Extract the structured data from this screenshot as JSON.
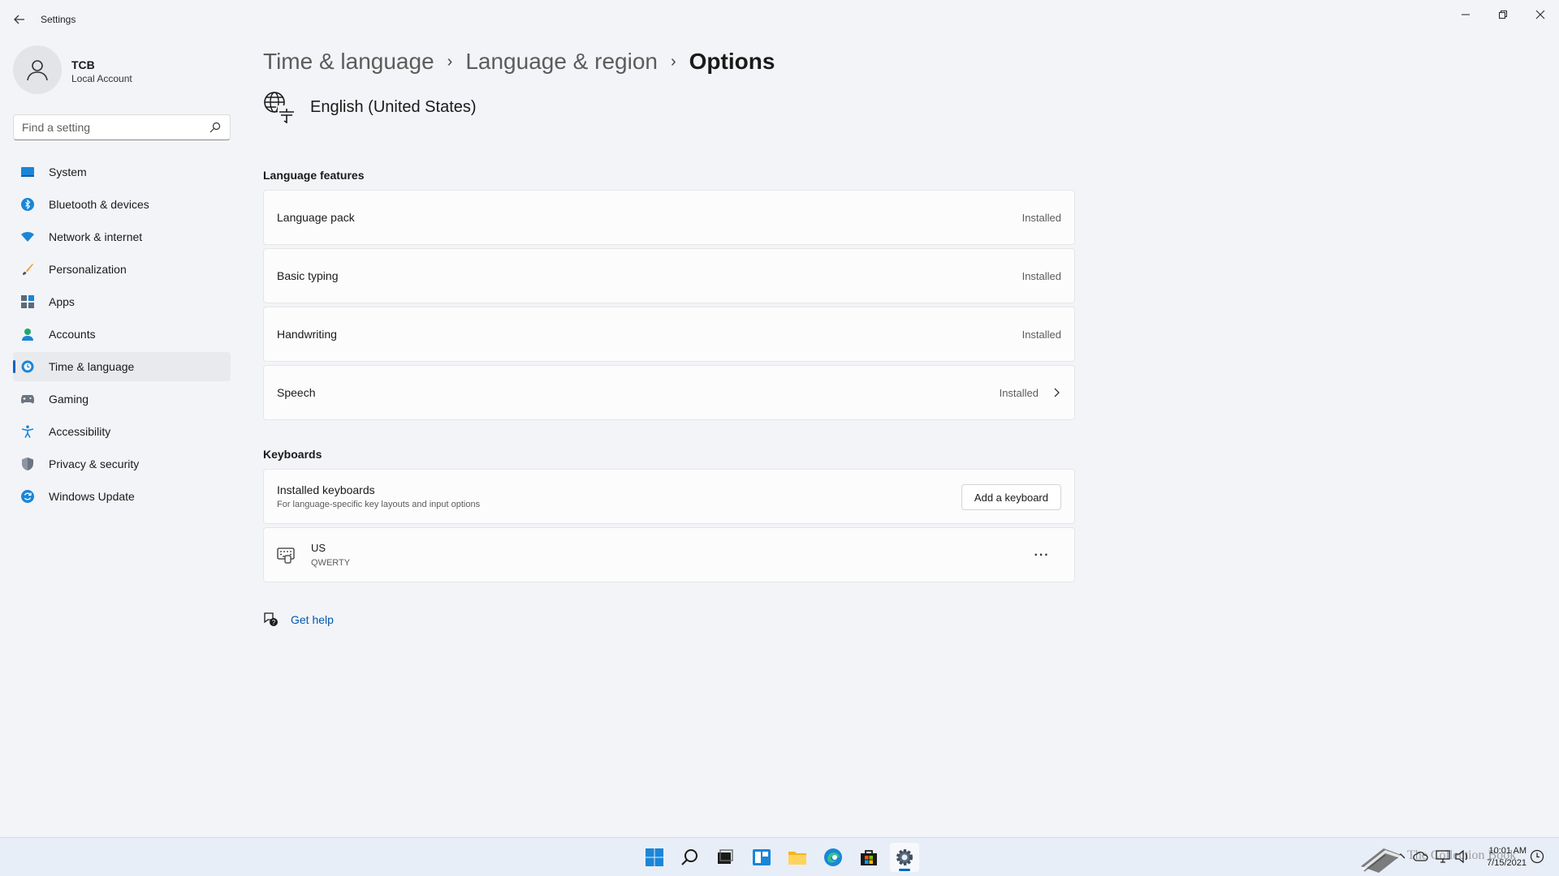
{
  "window": {
    "title": "Settings"
  },
  "profile": {
    "name": "TCB",
    "account_type": "Local Account"
  },
  "search": {
    "placeholder": "Find a setting"
  },
  "sidebar": {
    "items": [
      {
        "label": "System",
        "icon": "monitor-icon",
        "active": false
      },
      {
        "label": "Bluetooth & devices",
        "icon": "bluetooth-icon",
        "active": false
      },
      {
        "label": "Network & internet",
        "icon": "wifi-icon",
        "active": false
      },
      {
        "label": "Personalization",
        "icon": "brush-icon",
        "active": false
      },
      {
        "label": "Apps",
        "icon": "apps-icon",
        "active": false
      },
      {
        "label": "Accounts",
        "icon": "person-icon",
        "active": false
      },
      {
        "label": "Time & language",
        "icon": "globe-clock-icon",
        "active": true
      },
      {
        "label": "Gaming",
        "icon": "gamepad-icon",
        "active": false
      },
      {
        "label": "Accessibility",
        "icon": "accessibility-icon",
        "active": false
      },
      {
        "label": "Privacy & security",
        "icon": "shield-icon",
        "active": false
      },
      {
        "label": "Windows Update",
        "icon": "update-icon",
        "active": false
      }
    ]
  },
  "breadcrumb": {
    "items": [
      "Time & language",
      "Language & region",
      "Options"
    ]
  },
  "language": {
    "name": "English (United States)"
  },
  "language_features": {
    "title": "Language features",
    "items": [
      {
        "label": "Language pack",
        "status": "Installed"
      },
      {
        "label": "Basic typing",
        "status": "Installed"
      },
      {
        "label": "Handwriting",
        "status": "Installed"
      },
      {
        "label": "Speech",
        "status": "Installed"
      }
    ]
  },
  "keyboards": {
    "title": "Keyboards",
    "installed_title": "Installed keyboards",
    "installed_desc": "For language-specific key layouts and input options",
    "add_button": "Add a keyboard",
    "items": [
      {
        "name": "US",
        "layout": "QWERTY"
      }
    ],
    "more_label": "···"
  },
  "help": {
    "label": "Get help"
  },
  "taskbar": {
    "clock_time": "10:01 AM",
    "clock_date": "7/15/2021",
    "watermark": "The Collection Book",
    "accent": "#0067c0"
  }
}
